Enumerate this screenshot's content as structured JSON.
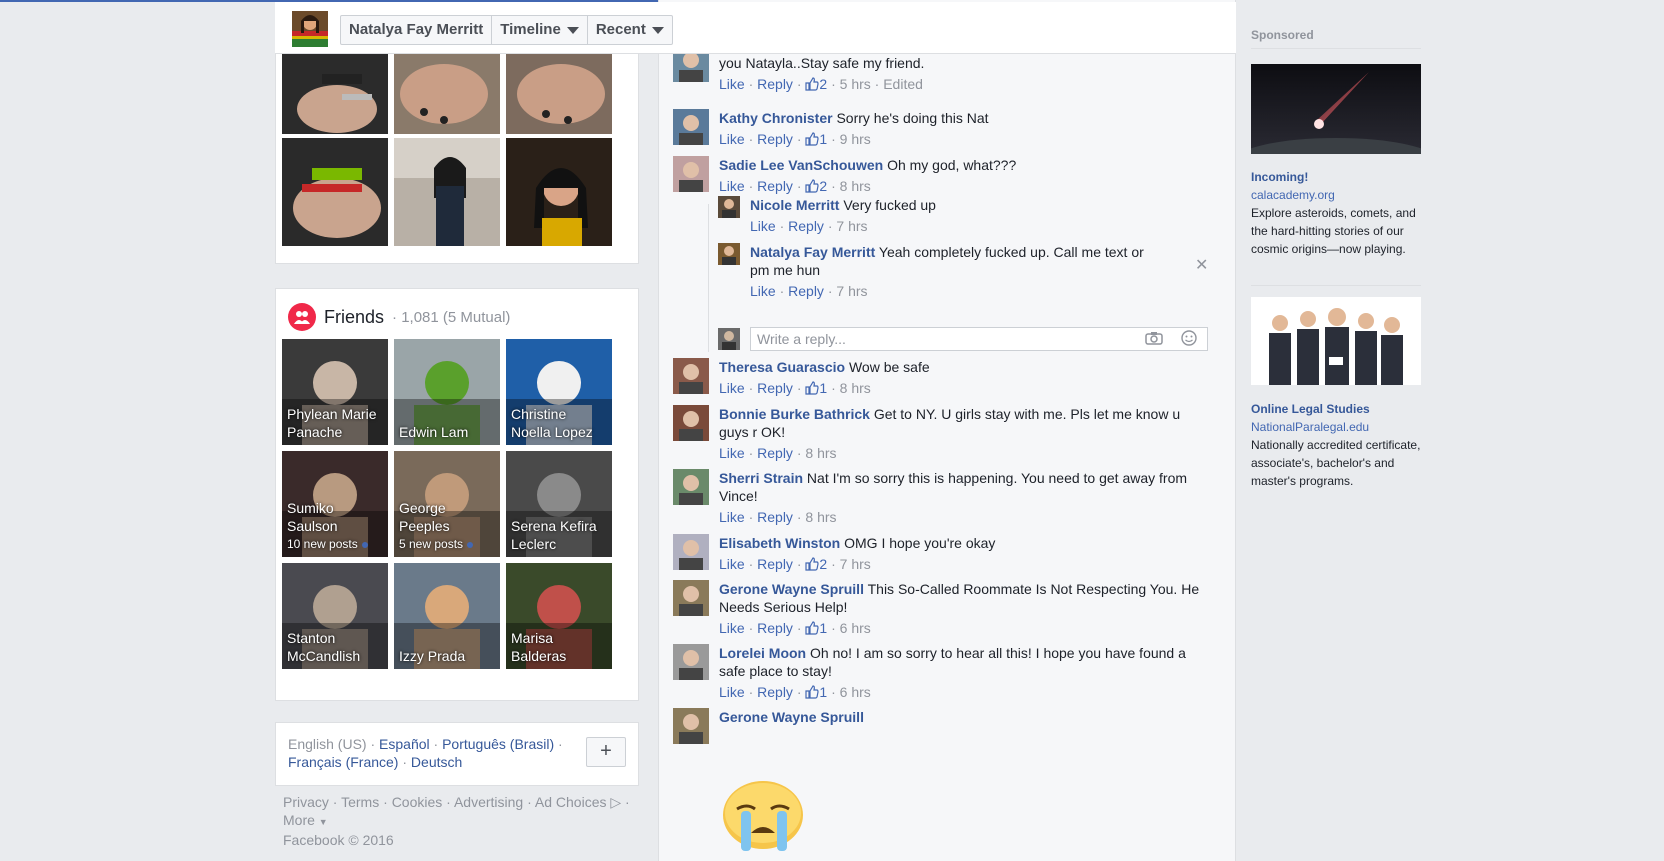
{
  "header": {
    "profile_name": "Natalya Fay Merritt",
    "timeline_label": "Timeline",
    "recent_label": "Recent"
  },
  "friends": {
    "title": "Friends",
    "count": "· 1,081 (5 Mutual)",
    "items": [
      {
        "name": "Phylean Marie Panache",
        "sub": ""
      },
      {
        "name": "Edwin Lam",
        "sub": ""
      },
      {
        "name": "Christine Noella Lopez",
        "sub": ""
      },
      {
        "name": "Sumiko Saulson",
        "sub": "10 new posts"
      },
      {
        "name": "George Peeples",
        "sub": "5 new posts"
      },
      {
        "name": "Serena Kefira Leclerc",
        "sub": ""
      },
      {
        "name": "Stanton McCandlish",
        "sub": ""
      },
      {
        "name": "Izzy Prada",
        "sub": ""
      },
      {
        "name": "Marisa Balderas",
        "sub": ""
      }
    ]
  },
  "languages": {
    "current": "English (US)",
    "options": [
      "Español",
      "Português (Brasil)",
      "Français (France)",
      "Deutsch"
    ],
    "add_label": "+"
  },
  "footer": {
    "links": [
      "Privacy",
      "Terms",
      "Cookies",
      "Advertising",
      "Ad Choices",
      "More"
    ],
    "copyright": "Facebook © 2016"
  },
  "actions": {
    "like": "Like",
    "reply": "Reply"
  },
  "comments": [
    {
      "name": "",
      "text": "you Natayla..Stay safe my friend.",
      "likes": "2",
      "time": "5 hrs",
      "edited": "Edited"
    },
    {
      "name": "Kathy Chronister",
      "text": "Sorry he's doing this Nat",
      "likes": "1",
      "time": "9 hrs"
    },
    {
      "name": "Sadie Lee VanSchouwen",
      "text": "Oh my god, what???",
      "likes": "2",
      "time": "8 hrs"
    },
    {
      "name": "Theresa Guarascio",
      "text": "Wow be safe",
      "likes": "1",
      "time": "8 hrs"
    },
    {
      "name": "Bonnie Burke Bathrick",
      "text": "Get to NY. U girls stay with me. Pls let me know u guys r OK!",
      "likes": "",
      "time": "8 hrs"
    },
    {
      "name": "Sherri Strain",
      "text": "Nat I'm so sorry this is happening. You need to get away from Vince!",
      "likes": "",
      "time": "8 hrs"
    },
    {
      "name": "Elisabeth Winston",
      "text": "OMG I hope you're okay",
      "likes": "2",
      "time": "7 hrs"
    },
    {
      "name": "Gerone Wayne Spruill",
      "text": "This So-Called Roommate Is Not Respecting You. He Needs Serious Help!",
      "likes": "1",
      "time": "6 hrs"
    },
    {
      "name": "Lorelei Moon",
      "text": "Oh no! I am so sorry to hear all this! I hope you have found a safe place to stay!",
      "likes": "1",
      "time": "6 hrs"
    },
    {
      "name": "Gerone Wayne Spruill",
      "text": "",
      "likes": "",
      "time": ""
    }
  ],
  "replies": [
    {
      "name": "Nicole Merritt",
      "text": "Very fucked up",
      "time": "7 hrs"
    },
    {
      "name": "Natalya Fay Merritt",
      "text": "Yeah completely fucked up. Call me text or pm me hun",
      "time": "7 hrs"
    }
  ],
  "write_reply_placeholder": "Write a reply...",
  "sidebar": {
    "sponsored_label": "Sponsored",
    "ads": [
      {
        "title": "Incoming!",
        "domain": "calacademy.org",
        "desc": "Explore asteroids, comets, and the hard-hitting stories of our cosmic origins—now playing."
      },
      {
        "title": "Online Legal Studies",
        "domain": "NationalParalegal.edu",
        "desc": "Nationally accredited certificate, associate's, bachelor's and master's programs."
      }
    ]
  }
}
